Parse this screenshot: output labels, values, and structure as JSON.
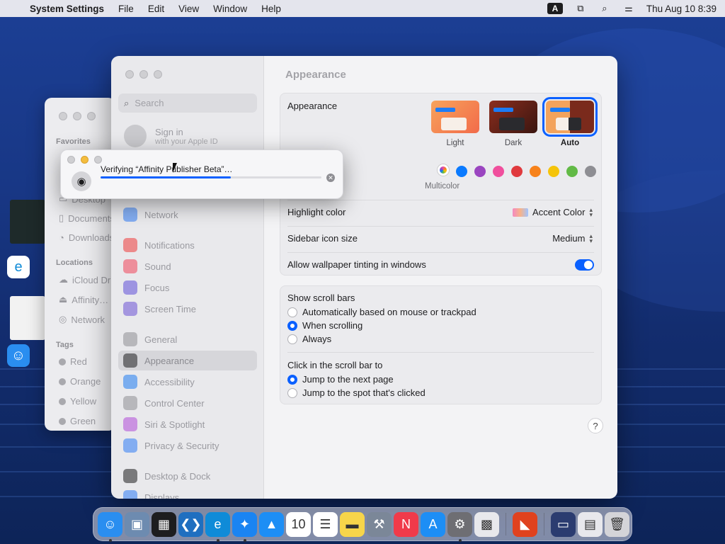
{
  "menubar": {
    "app_name": "System Settings",
    "menus": [
      "File",
      "Edit",
      "View",
      "Window",
      "Help"
    ],
    "input_badge": "A",
    "datetime": "Thu Aug 10  8:39"
  },
  "finder": {
    "favorites_label": "Favorites",
    "favorites": [
      "Desktop",
      "Documents",
      "Downloads"
    ],
    "locations_label": "Locations",
    "locations": [
      "iCloud Drive",
      "Affinity…",
      "Network"
    ],
    "tags_label": "Tags",
    "tags": [
      "Red",
      "Orange",
      "Yellow",
      "Green"
    ]
  },
  "settings": {
    "search_placeholder": "Search",
    "signin_title": "Sign in",
    "signin_subtitle": "with your Apple ID",
    "sidebar": [
      {
        "label": "Network",
        "color": "#2f7cf6"
      },
      {
        "label": "Notifications",
        "color": "#ef3b3b"
      },
      {
        "label": "Sound",
        "color": "#f0445a"
      },
      {
        "label": "Focus",
        "color": "#5e4fd8"
      },
      {
        "label": "Screen Time",
        "color": "#6b52d6"
      },
      {
        "label": "General",
        "color": "#8e8e93"
      },
      {
        "label": "Appearance",
        "color": "#1d1d1f"
      },
      {
        "label": "Accessibility",
        "color": "#1f7cf2"
      },
      {
        "label": "Control Center",
        "color": "#8e8e93"
      },
      {
        "label": "Siri & Spotlight",
        "color": "#b04ad8"
      },
      {
        "label": "Privacy & Security",
        "color": "#2f7cf6"
      },
      {
        "label": "Desktop & Dock",
        "color": "#1d1d1f"
      },
      {
        "label": "Displays",
        "color": "#2f7cf6"
      }
    ],
    "selected_item": "Appearance",
    "page_title": "Appearance",
    "appearance_label": "Appearance",
    "appearance_options": [
      "Light",
      "Dark",
      "Auto"
    ],
    "appearance_selected": "Auto",
    "accent_label": "Multicolor",
    "accent_colors": [
      "#0a7aff",
      "#9a45c0",
      "#f04f9d",
      "#e03a3e",
      "#f7821b",
      "#f5c40a",
      "#62ba46",
      "#8e8e93"
    ],
    "highlight_label": "Highlight color",
    "highlight_value": "Accent Color",
    "sidebar_icon_label": "Sidebar icon size",
    "sidebar_icon_value": "Medium",
    "tinting_label": "Allow wallpaper tinting in windows",
    "tinting_on": true,
    "scroll_bars_label": "Show scroll bars",
    "scroll_options": [
      "Automatically based on mouse or trackpad",
      "When scrolling",
      "Always"
    ],
    "scroll_selected": "When scrolling",
    "click_label": "Click in the scroll bar to",
    "click_options": [
      "Jump to the next page",
      "Jump to the spot that's clicked"
    ],
    "click_selected": "Jump to the next page",
    "help": "?"
  },
  "verify_dialog": {
    "text": "Verifying “Affinity Publisher Beta”…",
    "progress": 0.59
  },
  "dock": {
    "apps": [
      {
        "name": "finder",
        "glyph": "☺",
        "bg": "#2a8ef0",
        "running": true
      },
      {
        "name": "preview",
        "glyph": "▣",
        "bg": "#6d8bb0",
        "running": false
      },
      {
        "name": "mission-control",
        "glyph": "▦",
        "bg": "#1d1d1f",
        "running": false
      },
      {
        "name": "vscode",
        "glyph": "❮❯",
        "bg": "#1f6fc0",
        "running": false
      },
      {
        "name": "edge",
        "glyph": "e",
        "bg": "#0f8bd8",
        "running": true
      },
      {
        "name": "safari",
        "glyph": "✦",
        "bg": "#1a84f2",
        "running": true
      },
      {
        "name": "keynote",
        "glyph": "▲",
        "bg": "#1d8ef5",
        "running": false
      },
      {
        "name": "calendar",
        "glyph": "10",
        "bg": "#ffffff",
        "running": false
      },
      {
        "name": "reminders",
        "glyph": "☰",
        "bg": "#ffffff",
        "running": false
      },
      {
        "name": "notes",
        "glyph": "▬",
        "bg": "#f7d54a",
        "running": false
      },
      {
        "name": "xcode-tools",
        "glyph": "⚒",
        "bg": "#7b8798",
        "running": false
      },
      {
        "name": "news",
        "glyph": "N",
        "bg": "#f03a4a",
        "running": false
      },
      {
        "name": "app-store",
        "glyph": "A",
        "bg": "#1d8ef5",
        "running": false
      },
      {
        "name": "system-settings",
        "glyph": "⚙",
        "bg": "#6e6e73",
        "running": true
      },
      {
        "name": "launchpad",
        "glyph": "▩",
        "bg": "#e8e8ec",
        "running": false
      },
      {
        "name": "affinity-publisher",
        "glyph": "◣",
        "bg": "#e0421e",
        "running": false
      },
      {
        "name": "screen-sharing",
        "glyph": "▭",
        "bg": "#2b3c70",
        "running": false
      },
      {
        "name": "downloads-stack",
        "glyph": "▤",
        "bg": "#e8e8ec",
        "running": false
      },
      {
        "name": "trash",
        "glyph": "🗑",
        "bg": "#d4d4d8",
        "running": false
      }
    ]
  }
}
